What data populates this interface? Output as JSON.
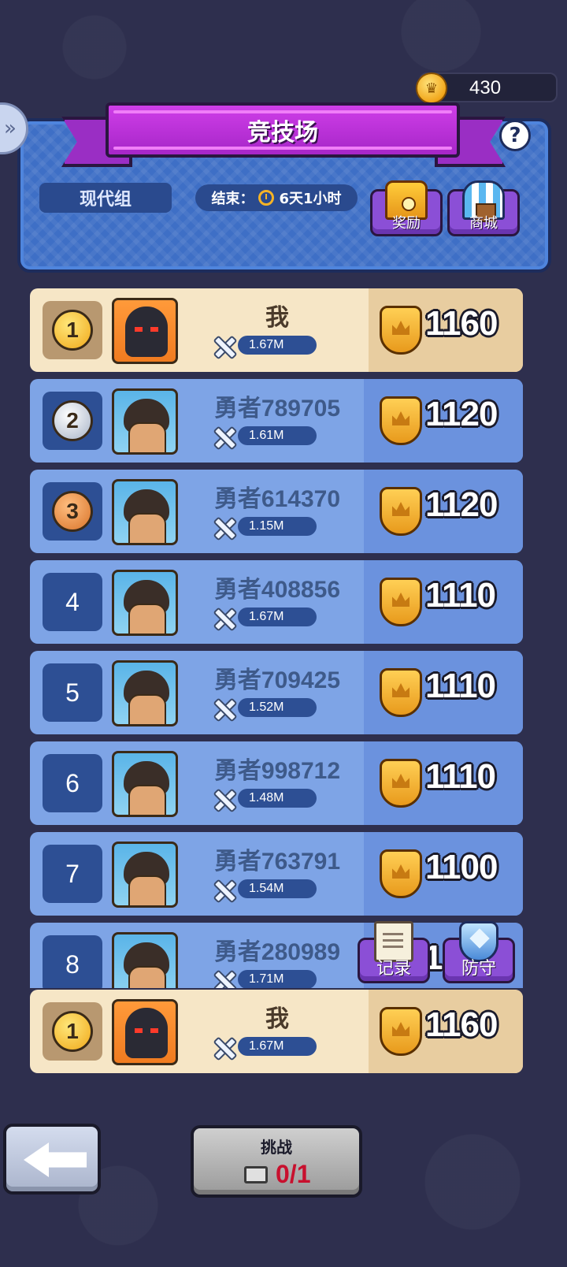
{
  "currency": {
    "icon": "crown-coin-icon",
    "amount": "430"
  },
  "header": {
    "title": "竞技场",
    "group": "现代组",
    "end_label": "结束：",
    "end_time": "6天1小时",
    "reward_label": "奖励",
    "shop_label": "商城"
  },
  "rankings": [
    {
      "rank": "1",
      "name": "我",
      "power": "1.67M",
      "score": "1160"
    },
    {
      "rank": "2",
      "name": "勇者789705",
      "power": "1.61M",
      "score": "1120"
    },
    {
      "rank": "3",
      "name": "勇者614370",
      "power": "1.15M",
      "score": "1120"
    },
    {
      "rank": "4",
      "name": "勇者408856",
      "power": "1.67M",
      "score": "1110"
    },
    {
      "rank": "5",
      "name": "勇者709425",
      "power": "1.52M",
      "score": "1110"
    },
    {
      "rank": "6",
      "name": "勇者998712",
      "power": "1.48M",
      "score": "1110"
    },
    {
      "rank": "7",
      "name": "勇者763791",
      "power": "1.54M",
      "score": "1100"
    },
    {
      "rank": "8",
      "name": "勇者280989",
      "power": "1.71M",
      "score": "1"
    }
  ],
  "floating": {
    "record_label": "记录",
    "defense_label": "防守"
  },
  "me": {
    "rank": "1",
    "name": "我",
    "power": "1.67M",
    "score": "1160"
  },
  "bottom": {
    "challenge_label": "挑战",
    "challenge_count": "0/1"
  },
  "colors": {
    "accent": "#a626c8",
    "panel": "#3e6fc6",
    "row": "#7ea4e6",
    "me_row": "#f6e6c6",
    "score_red": "#c8102e"
  }
}
